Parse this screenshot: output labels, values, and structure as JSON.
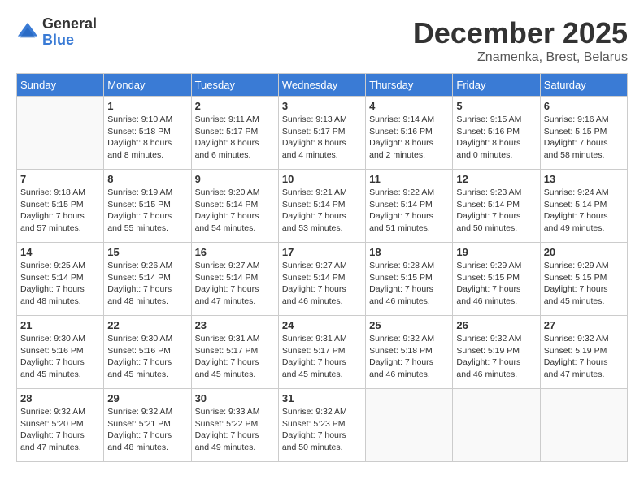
{
  "logo": {
    "general": "General",
    "blue": "Blue"
  },
  "title": "December 2025",
  "location": "Znamenka, Brest, Belarus",
  "weekdays": [
    "Sunday",
    "Monday",
    "Tuesday",
    "Wednesday",
    "Thursday",
    "Friday",
    "Saturday"
  ],
  "weeks": [
    [
      {
        "day": "",
        "info": ""
      },
      {
        "day": "1",
        "info": "Sunrise: 9:10 AM\nSunset: 5:18 PM\nDaylight: 8 hours\nand 8 minutes."
      },
      {
        "day": "2",
        "info": "Sunrise: 9:11 AM\nSunset: 5:17 PM\nDaylight: 8 hours\nand 6 minutes."
      },
      {
        "day": "3",
        "info": "Sunrise: 9:13 AM\nSunset: 5:17 PM\nDaylight: 8 hours\nand 4 minutes."
      },
      {
        "day": "4",
        "info": "Sunrise: 9:14 AM\nSunset: 5:16 PM\nDaylight: 8 hours\nand 2 minutes."
      },
      {
        "day": "5",
        "info": "Sunrise: 9:15 AM\nSunset: 5:16 PM\nDaylight: 8 hours\nand 0 minutes."
      },
      {
        "day": "6",
        "info": "Sunrise: 9:16 AM\nSunset: 5:15 PM\nDaylight: 7 hours\nand 58 minutes."
      }
    ],
    [
      {
        "day": "7",
        "info": "Sunrise: 9:18 AM\nSunset: 5:15 PM\nDaylight: 7 hours\nand 57 minutes."
      },
      {
        "day": "8",
        "info": "Sunrise: 9:19 AM\nSunset: 5:15 PM\nDaylight: 7 hours\nand 55 minutes."
      },
      {
        "day": "9",
        "info": "Sunrise: 9:20 AM\nSunset: 5:14 PM\nDaylight: 7 hours\nand 54 minutes."
      },
      {
        "day": "10",
        "info": "Sunrise: 9:21 AM\nSunset: 5:14 PM\nDaylight: 7 hours\nand 53 minutes."
      },
      {
        "day": "11",
        "info": "Sunrise: 9:22 AM\nSunset: 5:14 PM\nDaylight: 7 hours\nand 51 minutes."
      },
      {
        "day": "12",
        "info": "Sunrise: 9:23 AM\nSunset: 5:14 PM\nDaylight: 7 hours\nand 50 minutes."
      },
      {
        "day": "13",
        "info": "Sunrise: 9:24 AM\nSunset: 5:14 PM\nDaylight: 7 hours\nand 49 minutes."
      }
    ],
    [
      {
        "day": "14",
        "info": "Sunrise: 9:25 AM\nSunset: 5:14 PM\nDaylight: 7 hours\nand 48 minutes."
      },
      {
        "day": "15",
        "info": "Sunrise: 9:26 AM\nSunset: 5:14 PM\nDaylight: 7 hours\nand 48 minutes."
      },
      {
        "day": "16",
        "info": "Sunrise: 9:27 AM\nSunset: 5:14 PM\nDaylight: 7 hours\nand 47 minutes."
      },
      {
        "day": "17",
        "info": "Sunrise: 9:27 AM\nSunset: 5:14 PM\nDaylight: 7 hours\nand 46 minutes."
      },
      {
        "day": "18",
        "info": "Sunrise: 9:28 AM\nSunset: 5:15 PM\nDaylight: 7 hours\nand 46 minutes."
      },
      {
        "day": "19",
        "info": "Sunrise: 9:29 AM\nSunset: 5:15 PM\nDaylight: 7 hours\nand 46 minutes."
      },
      {
        "day": "20",
        "info": "Sunrise: 9:29 AM\nSunset: 5:15 PM\nDaylight: 7 hours\nand 45 minutes."
      }
    ],
    [
      {
        "day": "21",
        "info": "Sunrise: 9:30 AM\nSunset: 5:16 PM\nDaylight: 7 hours\nand 45 minutes."
      },
      {
        "day": "22",
        "info": "Sunrise: 9:30 AM\nSunset: 5:16 PM\nDaylight: 7 hours\nand 45 minutes."
      },
      {
        "day": "23",
        "info": "Sunrise: 9:31 AM\nSunset: 5:17 PM\nDaylight: 7 hours\nand 45 minutes."
      },
      {
        "day": "24",
        "info": "Sunrise: 9:31 AM\nSunset: 5:17 PM\nDaylight: 7 hours\nand 45 minutes."
      },
      {
        "day": "25",
        "info": "Sunrise: 9:32 AM\nSunset: 5:18 PM\nDaylight: 7 hours\nand 46 minutes."
      },
      {
        "day": "26",
        "info": "Sunrise: 9:32 AM\nSunset: 5:19 PM\nDaylight: 7 hours\nand 46 minutes."
      },
      {
        "day": "27",
        "info": "Sunrise: 9:32 AM\nSunset: 5:19 PM\nDaylight: 7 hours\nand 47 minutes."
      }
    ],
    [
      {
        "day": "28",
        "info": "Sunrise: 9:32 AM\nSunset: 5:20 PM\nDaylight: 7 hours\nand 47 minutes."
      },
      {
        "day": "29",
        "info": "Sunrise: 9:32 AM\nSunset: 5:21 PM\nDaylight: 7 hours\nand 48 minutes."
      },
      {
        "day": "30",
        "info": "Sunrise: 9:33 AM\nSunset: 5:22 PM\nDaylight: 7 hours\nand 49 minutes."
      },
      {
        "day": "31",
        "info": "Sunrise: 9:32 AM\nSunset: 5:23 PM\nDaylight: 7 hours\nand 50 minutes."
      },
      {
        "day": "",
        "info": ""
      },
      {
        "day": "",
        "info": ""
      },
      {
        "day": "",
        "info": ""
      }
    ]
  ]
}
